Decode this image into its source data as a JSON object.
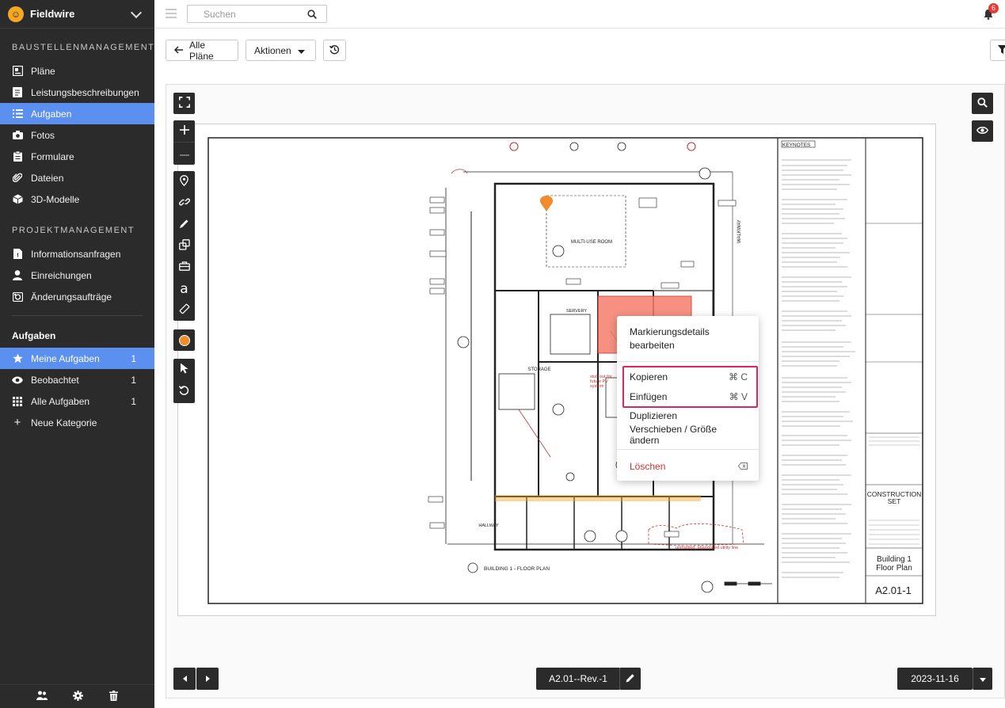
{
  "brand": {
    "name": "Fieldwire"
  },
  "sidebar": {
    "section_baustelle": "BAUSTELLENMANAGEMENT",
    "section_projekt": "PROJEKTMANAGEMENT",
    "baustelle_items": [
      {
        "label": "Pläne",
        "icon": "plans-icon"
      },
      {
        "label": "Leistungsbeschreibungen",
        "icon": "specs-icon"
      },
      {
        "label": "Aufgaben",
        "icon": "tasks-list-icon",
        "active": true
      },
      {
        "label": "Fotos",
        "icon": "camera-icon"
      },
      {
        "label": "Formulare",
        "icon": "clipboard-icon"
      },
      {
        "label": "Dateien",
        "icon": "paperclip-icon"
      },
      {
        "label": "3D-Modelle",
        "icon": "cube-icon"
      }
    ],
    "projekt_items": [
      {
        "label": "Informationsanfragen",
        "icon": "rfi-doc-icon"
      },
      {
        "label": "Einreichungen",
        "icon": "person-icon"
      },
      {
        "label": "Änderungsaufträge",
        "icon": "change-order-icon"
      }
    ],
    "tasks_title": "Aufgaben",
    "task_filters": [
      {
        "label": "Meine Aufgaben",
        "count": "1",
        "icon": "star-icon",
        "active": true
      },
      {
        "label": "Beobachtet",
        "count": "1",
        "icon": "eye-icon"
      },
      {
        "label": "Alle Aufgaben",
        "count": "1",
        "icon": "grid-icon"
      },
      {
        "label": "Neue Kategorie",
        "count": "",
        "icon": "plus-icon"
      }
    ]
  },
  "topbar": {
    "search_placeholder": "Suchen",
    "notification_count": "6"
  },
  "toolbar": {
    "back_label": "Alle Pläne",
    "actions_label": "Aktionen"
  },
  "context_menu": {
    "edit_details": "Markierungsdetails bearbeiten",
    "copy": "Kopieren",
    "copy_shortcut": "⌘ C",
    "paste": "Einfügen",
    "paste_shortcut": "⌘ V",
    "duplicate": "Duplizieren",
    "move_resize": "Verschieben / Größe ändern",
    "delete": "Löschen"
  },
  "plan": {
    "title_line1": "Building 1",
    "title_line2": "Floor Plan",
    "set_label_line1": "CONSTRUCTION",
    "set_label_line2": "SET",
    "sheet_number": "A2.01-1",
    "plan_caption": "BUILDING 1 - FLOOR PLAN",
    "room_multi_use": "MULTI-USE ROOM",
    "room_storage": "STORAGE",
    "room_servery": "SERVERY",
    "room_hallway": "HALLWAY",
    "keynotes_title": "KEYNOTES",
    "walkway": "WALKWAY"
  },
  "bottom": {
    "sheet_label": "A2.01--Rev.-1",
    "date": "2023-11-16"
  },
  "colors": {
    "accent": "#5b8ff0",
    "highlight": "#e0245e",
    "markup_red": "#f47c6b",
    "delete_red": "#d32f2f"
  }
}
